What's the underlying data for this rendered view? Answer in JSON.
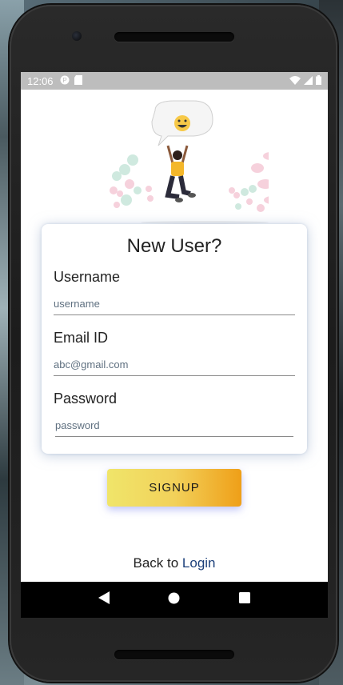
{
  "statusbar": {
    "time": "12:06",
    "icons": [
      "notification-icon",
      "sd-card-icon",
      "wifi-icon",
      "signal-icon",
      "battery-icon"
    ]
  },
  "card": {
    "title": "New User?",
    "fields": [
      {
        "label": "Username",
        "placeholder": "username"
      },
      {
        "label": "Email ID",
        "placeholder": "abc@gmail.com"
      },
      {
        "label": "Password",
        "placeholder": "password"
      }
    ]
  },
  "signup_button": {
    "label": "SIGNUP"
  },
  "footer": {
    "prefix": "Back to ",
    "link": "Login"
  },
  "navbar": {
    "icons": [
      "back-icon",
      "home-icon",
      "recents-icon"
    ]
  },
  "colors": {
    "button_gradient_start": "#f0e56a",
    "button_gradient_end": "#ef9f18",
    "link": "#1b3f7a",
    "statusbar": "#bdbdbd"
  }
}
